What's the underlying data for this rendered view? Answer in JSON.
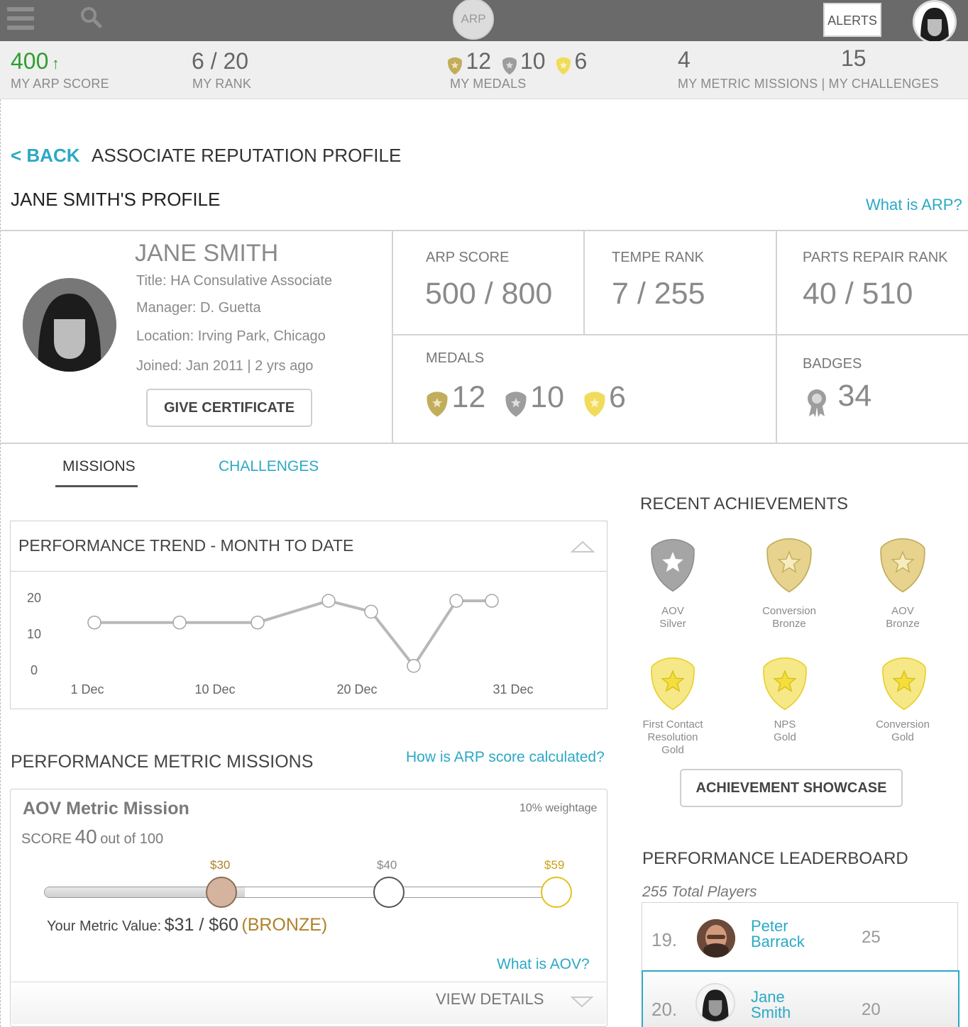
{
  "topbar": {
    "logo": "ARP",
    "alerts_label": "ALERTS"
  },
  "stats": {
    "arp_score": "400",
    "arp_score_label": "MY ARP SCORE",
    "rank": "6 / 20",
    "rank_label": "MY RANK",
    "medals": {
      "gold": "12",
      "silver": "10",
      "bronze": "6"
    },
    "medals_label": "MY MEDALS",
    "metric_missions": "4",
    "challenges": "15",
    "missions_challenges_label": "MY METRIC MISSIONS | MY CHALLENGES"
  },
  "page": {
    "back_label": "< BACK",
    "title": "ASSOCIATE REPUTATION PROFILE",
    "profile_heading": "JANE SMITH'S PROFILE",
    "what_is_arp": "What is ARP?"
  },
  "profile": {
    "name": "JANE SMITH",
    "title": "Title: HA Consulative Associate",
    "manager": "Manager: D. Guetta",
    "location": "Location: Irving Park, Chicago",
    "joined": "Joined: Jan 2011 | 2 yrs ago",
    "give_certificate": "GIVE CERTIFICATE"
  },
  "profile_stats": {
    "arp_score_label": "ARP SCORE",
    "arp_score_value": "500 / 800",
    "tempe_rank_label": "TEMPE RANK",
    "tempe_rank_value": "7 / 255",
    "parts_rank_label": "PARTS REPAIR RANK",
    "parts_rank_value": "40 / 510",
    "medals_label": "MEDALS",
    "medals": {
      "gold": "12",
      "silver": "10",
      "bronze": "6"
    },
    "badges_label": "BADGES",
    "badges_value": "34"
  },
  "tabs": [
    {
      "label": "MISSIONS",
      "active": true
    },
    {
      "label": "CHALLENGES",
      "active": false
    }
  ],
  "trend": {
    "title": "PERFORMANCE TREND - MONTH TO DATE"
  },
  "chart_data": {
    "type": "line",
    "title": "PERFORMANCE TREND - MONTH TO DATE",
    "x_ticks": [
      "1 Dec",
      "10 Dec",
      "20 Dec",
      "31 Dec"
    ],
    "y_ticks": [
      "20",
      "10",
      "0"
    ],
    "ylim": [
      0,
      20
    ],
    "x_day_range": [
      1,
      31
    ],
    "points": [
      {
        "x": 1.5,
        "y": 13
      },
      {
        "x": 7.5,
        "y": 13
      },
      {
        "x": 13,
        "y": 13
      },
      {
        "x": 18,
        "y": 19
      },
      {
        "x": 21,
        "y": 16
      },
      {
        "x": 24,
        "y": 1
      },
      {
        "x": 27,
        "y": 19
      },
      {
        "x": 29.5,
        "y": 19
      }
    ],
    "grid": false,
    "color": "#b8b8b8"
  },
  "missions": {
    "heading": "PERFORMANCE METRIC MISSIONS",
    "arp_calc_link": "How is ARP score calculated?",
    "card": {
      "name": "AOV Metric Mission",
      "weightage": "10% weightage",
      "score_prefix": "SCORE",
      "score": "40",
      "score_suffix": "out of 100",
      "slider_labels": [
        "$30",
        "$40",
        "$59"
      ],
      "slider_fill": 0.39,
      "value_prefix": "Your Metric Value:",
      "value": "$31 / $60",
      "value_level": "(BRONZE)",
      "what_is_aov": "What is AOV?",
      "view_details": "VIEW DETAILS"
    }
  },
  "achievements": {
    "heading": "RECENT ACHIEVEMENTS",
    "items": [
      {
        "label": "AOV\nSilver"
      },
      {
        "label": "Conversion\nBronze"
      },
      {
        "label": "AOV\nBronze"
      },
      {
        "label": "First Contact\nResolution\nGold"
      },
      {
        "label": "NPS\nGold"
      },
      {
        "label": "Conversion\nGold"
      }
    ],
    "showcase_button": "ACHIEVEMENT SHOWCASE"
  },
  "leaderboard": {
    "heading": "PERFORMANCE LEADERBOARD",
    "total": "255 Total Players",
    "rows": [
      {
        "rank": "19.",
        "first": "Peter",
        "last": "Barrack",
        "score": "25"
      },
      {
        "rank": "20.",
        "first": "Jane",
        "last": "Smith",
        "score": "20"
      }
    ]
  },
  "colors": {
    "teal": "#2ba9c4",
    "green": "#2e9e2e",
    "gold": "#c2ad5c",
    "silver": "#9d9d9d",
    "bronze_yellow": "#f0dc5a",
    "bronze_text": "#b0812a"
  }
}
